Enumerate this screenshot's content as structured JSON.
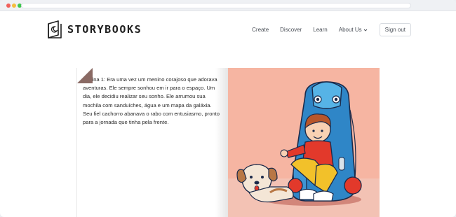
{
  "brand": {
    "name": "STORYBOOKS",
    "logo_icon": "book-moon-icon"
  },
  "nav": {
    "create": "Create",
    "discover": "Discover",
    "learn": "Learn",
    "about": "About Us",
    "signout": "Sign out"
  },
  "story": {
    "page_text": "Página 1: Era uma vez um menino corajoso que adorava aventuras. Ele sempre sonhou em ir para o espaço. Um dia, ele decidiu realizar seu sonho. Ele arrumou sua mochila com sanduíches, água e um mapa da galáxia. Seu fiel cachorro abanava o rabo com entusiasmo, pronto para a jornada que tinha pela frente."
  },
  "colors": {
    "illustration_bg": "#f6b5a2",
    "backpack_blue": "#2f86c7",
    "boy_shirt": "#e2392b",
    "boy_pants": "#f2c12a",
    "page_corner": "#8a6a64"
  }
}
